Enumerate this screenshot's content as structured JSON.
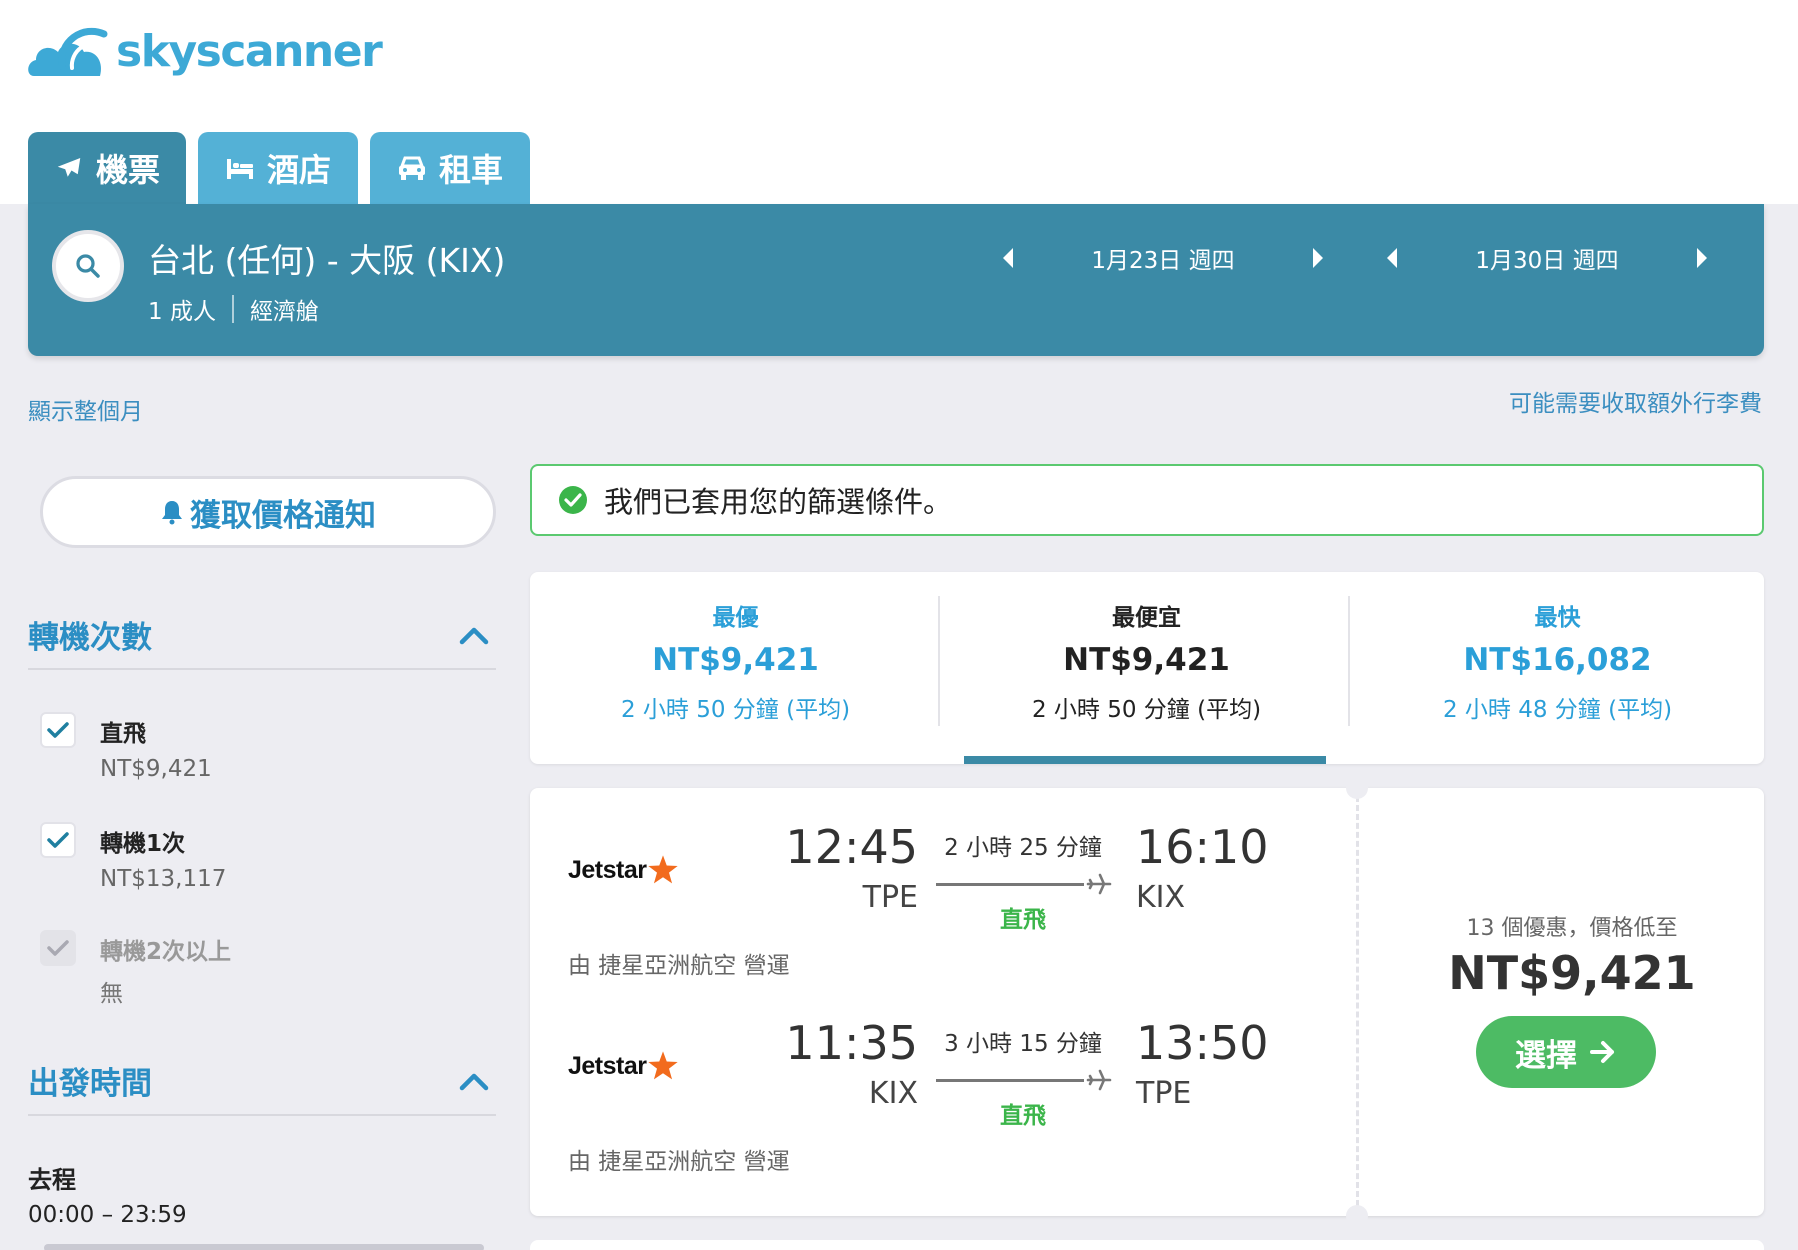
{
  "brand": {
    "name": "skyscanner",
    "color": "#3da9d6"
  },
  "tabs": [
    {
      "label": "機票",
      "icon": "plane-icon",
      "active": true
    },
    {
      "label": "酒店",
      "icon": "bed-icon",
      "active": false
    },
    {
      "label": "租車",
      "icon": "car-icon",
      "active": false
    }
  ],
  "search": {
    "route": "台北 (任何) - 大阪 (KIX)",
    "passengers": "1 成人",
    "cabin": "經濟艙",
    "depart_date": "1月23日 週四",
    "return_date": "1月30日 週四"
  },
  "links": {
    "show_month": "顯示整個月",
    "baggage": "可能需要收取額外行李費"
  },
  "sidebar": {
    "price_alert": "獲取價格通知",
    "stops": {
      "title": "轉機次數",
      "options": [
        {
          "label": "直飛",
          "price": "NT$9,421",
          "checked": true,
          "disabled": false
        },
        {
          "label": "轉機1次",
          "price": "NT$13,117",
          "checked": true,
          "disabled": false
        },
        {
          "label": "轉機2次以上",
          "price": "無",
          "checked": true,
          "disabled": true
        }
      ]
    },
    "departure_times": {
      "title": "出發時間",
      "leg_label": "去程",
      "range": "00:00 – 23:59"
    }
  },
  "applied_filters": "我們已套用您的篩選條件。",
  "sort": [
    {
      "title": "最優",
      "price": "NT$9,421",
      "duration": "2 小時 50 分鐘 (平均)",
      "selected": false
    },
    {
      "title": "最便宜",
      "price": "NT$9,421",
      "duration": "2 小時 50 分鐘 (平均)",
      "selected": true
    },
    {
      "title": "最快",
      "price": "NT$16,082",
      "duration": "2 小時 48 分鐘 (平均)",
      "selected": false
    }
  ],
  "result": {
    "legs": [
      {
        "airline": "Jetstar",
        "depart_time": "12:45",
        "depart_code": "TPE",
        "duration": "2 小時 25 分鐘",
        "stops": "直飛",
        "arrive_time": "16:10",
        "arrive_code": "KIX",
        "operated_by": "由 捷星亞洲航空 營運"
      },
      {
        "airline": "Jetstar",
        "depart_time": "11:35",
        "depart_code": "KIX",
        "duration": "3 小時 15 分鐘",
        "stops": "直飛",
        "arrive_time": "13:50",
        "arrive_code": "TPE",
        "operated_by": "由 捷星亞洲航空 營運"
      }
    ],
    "deals_text": "13 個優惠，價格低至",
    "price": "NT$9,421",
    "select_label": "選擇"
  },
  "colors": {
    "header_teal": "#3b8aa6",
    "tab_light": "#54b1d6",
    "link_blue": "#2b8ec4",
    "green": "#4dbb64",
    "jetstar_orange": "#f26b1d"
  }
}
